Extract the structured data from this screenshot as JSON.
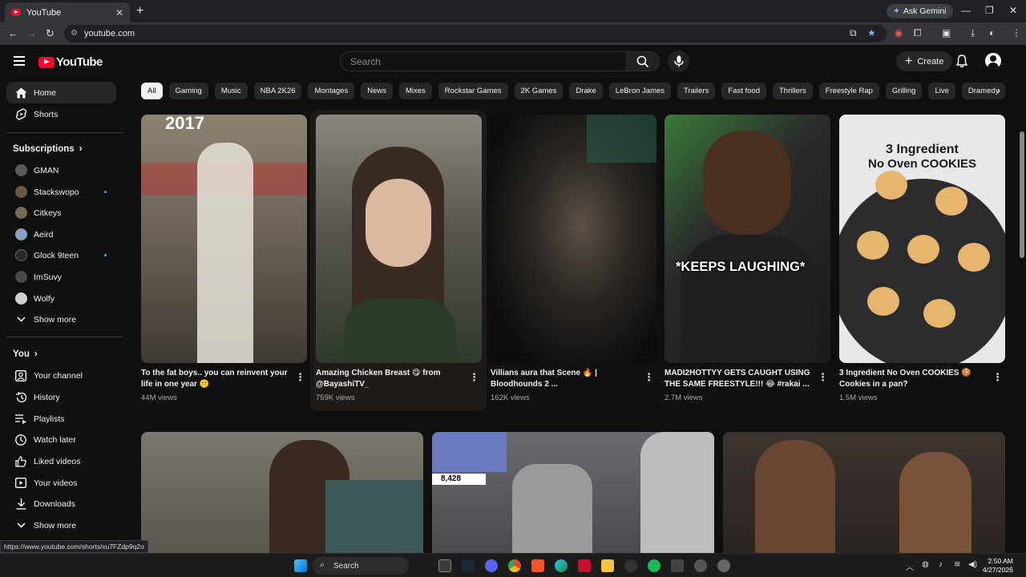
{
  "browser": {
    "tab_title": "YouTube",
    "tab_close": "✕",
    "new_tab": "+",
    "ask_gemini": "Ask Gemini",
    "url": "youtube.com",
    "window_min": "—",
    "window_max": "❐",
    "window_close": "✕",
    "status_url": "https://www.youtube.com/shorts/xu7FZdp9q2o"
  },
  "masthead": {
    "logo_text": "YouTube",
    "search_placeholder": "Search",
    "create_label": "Create"
  },
  "sidebar": {
    "home": "Home",
    "shorts": "Shorts",
    "subscriptions_heading": "Subscriptions",
    "subscriptions": [
      {
        "name": "GMAN",
        "color": "#5a5a5a",
        "dot": false
      },
      {
        "name": "Stackswopo",
        "color": "#6b5544",
        "dot": true
      },
      {
        "name": "Citkeys",
        "color": "#7a6a55",
        "dot": false
      },
      {
        "name": "Aeird",
        "color": "#8aa0c8",
        "dot": false
      },
      {
        "name": "Glock 9teen",
        "color": "#2a2a2a",
        "dot": true
      },
      {
        "name": "ImSuvy",
        "color": "#4a4a4a",
        "dot": false
      },
      {
        "name": "Wolfy",
        "color": "#d0d0d0",
        "dot": false
      }
    ],
    "show_more_1": "Show more",
    "you_heading": "You",
    "you_items": [
      {
        "label": "Your channel",
        "icon": "user-box-icon"
      },
      {
        "label": "History",
        "icon": "history-icon"
      },
      {
        "label": "Playlists",
        "icon": "playlist-icon"
      },
      {
        "label": "Watch later",
        "icon": "clock-icon"
      },
      {
        "label": "Liked videos",
        "icon": "thumbs-up-icon"
      },
      {
        "label": "Your videos",
        "icon": "play-box-icon"
      },
      {
        "label": "Downloads",
        "icon": "download-icon"
      }
    ],
    "show_more_2": "Show more"
  },
  "chips": [
    "All",
    "Gaming",
    "Music",
    "NBA 2K26",
    "Montages",
    "News",
    "Mixes",
    "Rockstar Games",
    "2K Games",
    "Drake",
    "LeBron James",
    "Trailers",
    "Fast food",
    "Thrillers",
    "Freestyle Rap",
    "Grilling",
    "Live",
    "Dramedy"
  ],
  "shorts": [
    {
      "title": "To the fat boys.. you can reinvent your life in one year 🤫",
      "views": "44M views",
      "overlay": "2017",
      "bg": "#6e6458"
    },
    {
      "title": "Amazing Chicken Breast 😋 from @BayashiTV_",
      "views": "759K views",
      "overlay": "",
      "bg": "#4a4540"
    },
    {
      "title": "Villians aura that Scene 🔥 | Bloodhounds 2 ...",
      "views": "162K views",
      "overlay": "",
      "bg": "#1c1c1a"
    },
    {
      "title": "MADI2HOTTYY GETS CAUGHT USING THE SAME FREESTYLE!!! 😂 #rakai ...",
      "views": "2.7M views",
      "overlay": "*KEEPS LAUGHING*",
      "bg": "#2d3a2a"
    },
    {
      "title": "3 Ingredient No Oven COOKIES 🍪 Cookies in a pan?",
      "views": "1.5M views",
      "overlay_line1": "3 Ingredient",
      "overlay_line2": "No Oven COOKIES",
      "bg": "#3a3a3a"
    }
  ],
  "row2": [
    {
      "bg": "#6a6660"
    },
    {
      "bg": "#5a5a5e",
      "badge": "8,428"
    },
    {
      "bg": "#3d3430"
    }
  ],
  "taskbar": {
    "search_label": "Search",
    "time": "2:50 AM",
    "date": "4/27/2026"
  }
}
